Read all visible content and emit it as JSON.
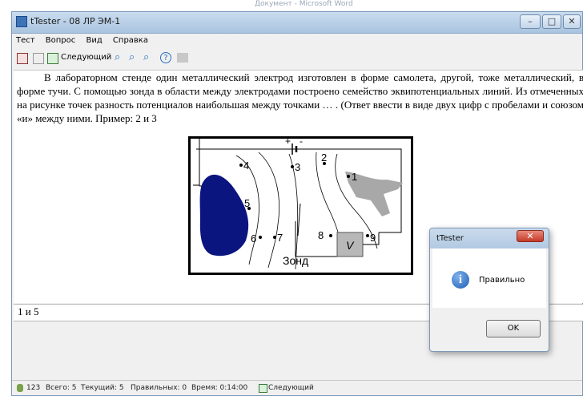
{
  "window": {
    "title": "tTester - 08 ЛР ЭМ-1",
    "background_title": "Документ - Microsoft Word"
  },
  "menu": [
    "Тест",
    "Вопрос",
    "Вид",
    "Справка"
  ],
  "toolbar": {
    "next_label": "Следующий"
  },
  "question": {
    "text": "В лабораторном стенде один металлический электрод изготовлен в форме самолета, другой, тоже металлический, в форме тучи. С помощью зонда в области между электродами построено семейство эквипотенциальных линий. Из отмеченных на рисунке точек разность потенциалов наибольшая между точками … . (Ответ ввести в виде двух цифр с пробелами и союзом «и» между ними. Пример: 2 и 3"
  },
  "figure": {
    "points": [
      "1",
      "2",
      "3",
      "4",
      "5",
      "6",
      "7",
      "8",
      "9"
    ],
    "probe_label": "Зонд",
    "voltmeter_label": "V",
    "plus": "+",
    "minus": "-"
  },
  "answer": {
    "value": "1 и 5"
  },
  "status": {
    "id": "123",
    "total": "Всего: 5",
    "current": "Текущий: 5",
    "correct": "Правильных: 0",
    "time": "Время: 0:14:00",
    "next": "Следующий"
  },
  "dialog": {
    "title": "tTester",
    "message": "Правильно",
    "ok_label": "OK"
  },
  "colors": {
    "cloud_electrode": "#0b1580",
    "plane_electrode": "#a8a8a8",
    "title_bar": "#bcd2ea"
  }
}
